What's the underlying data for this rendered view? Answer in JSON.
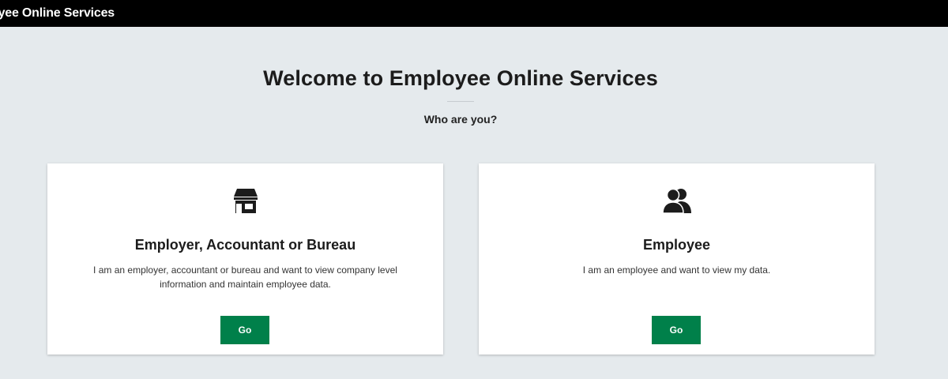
{
  "header": {
    "title": "oyee Online Services"
  },
  "main": {
    "title": "Welcome to Employee Online Services",
    "subtitle": "Who are you?"
  },
  "cards": [
    {
      "icon": "store-icon",
      "heading": "Employer, Accountant or Bureau",
      "description": "I am an employer, accountant or bureau and want to view company level information and maintain employee data.",
      "button_label": "Go"
    },
    {
      "icon": "users-icon",
      "heading": "Employee",
      "description": "I am an employee and want to view my data.",
      "button_label": "Go"
    }
  ],
  "colors": {
    "header_bg": "#000000",
    "page_bg": "#e5eaed",
    "button_green": "#00804a"
  }
}
